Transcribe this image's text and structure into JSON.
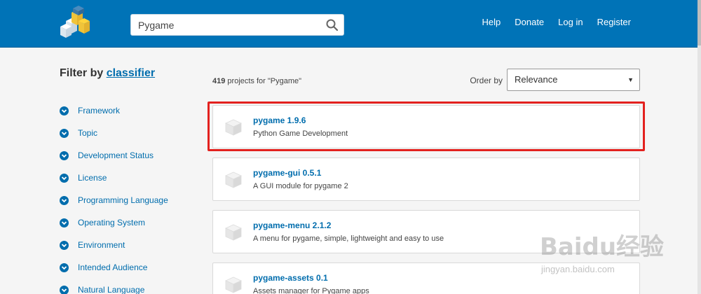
{
  "header": {
    "search_value": "Pygame",
    "nav": [
      "Help",
      "Donate",
      "Log in",
      "Register"
    ]
  },
  "sidebar": {
    "title_prefix": "Filter by",
    "title_link": "classifier",
    "items": [
      {
        "label": "Framework"
      },
      {
        "label": "Topic"
      },
      {
        "label": "Development Status"
      },
      {
        "label": "License"
      },
      {
        "label": "Programming Language"
      },
      {
        "label": "Operating System"
      },
      {
        "label": "Environment"
      },
      {
        "label": "Intended Audience"
      },
      {
        "label": "Natural Language"
      }
    ]
  },
  "results": {
    "count": "419",
    "count_text": " projects for \"Pygame\"",
    "order_label": "Order by",
    "order_value": "Relevance"
  },
  "projects": [
    {
      "name": "pygame 1.9.6",
      "description": "Python Game Development"
    },
    {
      "name": "pygame-gui 0.5.1",
      "description": "A GUI module for pygame 2"
    },
    {
      "name": "pygame-menu 2.1.2",
      "description": "A menu for pygame, simple, lightweight and easy to use"
    },
    {
      "name": "pygame-assets 0.1",
      "description": "Assets manager for Pygame apps"
    }
  ],
  "watermark": {
    "brand": "Baidu经验",
    "url": "jingyan.baidu.com"
  },
  "colors": {
    "header_bg": "#0073b7",
    "link": "#006dad",
    "highlight": "#e3211e"
  }
}
